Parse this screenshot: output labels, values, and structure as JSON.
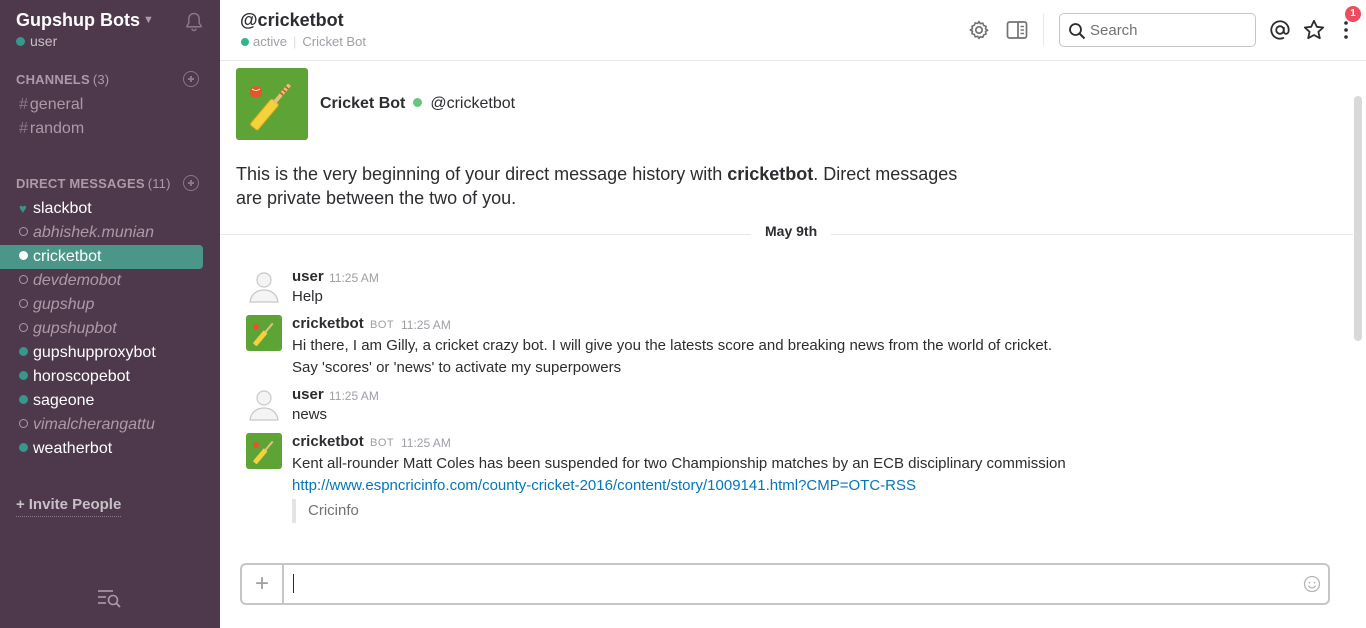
{
  "sidebar": {
    "team_name": "Gupshup Bots",
    "current_user": "user",
    "channels_header": "CHANNELS",
    "channels_count": "(3)",
    "channels": [
      {
        "label": "general"
      },
      {
        "label": "random"
      }
    ],
    "dm_header": "DIRECT MESSAGES",
    "dm_count": "(11)",
    "dms": [
      {
        "label": "slackbot",
        "status": "heart"
      },
      {
        "label": "abhishek.munian",
        "status": "away"
      },
      {
        "label": "cricketbot",
        "status": "selected"
      },
      {
        "label": "devdemobot",
        "status": "away"
      },
      {
        "label": "gupshup",
        "status": "away"
      },
      {
        "label": "gupshupbot",
        "status": "away"
      },
      {
        "label": "gupshupproxybot",
        "status": "active"
      },
      {
        "label": "horoscopebot",
        "status": "active"
      },
      {
        "label": "sageone",
        "status": "active"
      },
      {
        "label": "vimalcherangattu",
        "status": "away"
      },
      {
        "label": "weatherbot",
        "status": "active"
      }
    ],
    "invite_label": "Invite People",
    "invite_plus": "+"
  },
  "header": {
    "channel_title": "@cricketbot",
    "status": "active",
    "subtitle": "Cricket Bot",
    "search_placeholder": "Search",
    "notification_count": "1"
  },
  "intro": {
    "display_name": "Cricket Bot",
    "handle": "@cricketbot",
    "text_before": "This is the very beginning of your direct message history with ",
    "text_bold": "cricketbot",
    "text_after": ". Direct messages are private between the two of you."
  },
  "day_divider": "May 9th",
  "messages": [
    {
      "author": "user",
      "is_bot": false,
      "time": "11:25 AM",
      "lines": [
        "Help"
      ]
    },
    {
      "author": "cricketbot",
      "is_bot": true,
      "bot_label": "BOT",
      "time": "11:25 AM",
      "lines": [
        "Hi there, I am Gilly, a cricket crazy bot. I will give you the latests score and breaking news from the world of cricket.",
        "Say 'scores' or 'news' to activate my superpowers"
      ]
    },
    {
      "author": "user",
      "is_bot": false,
      "time": "11:25 AM",
      "lines": [
        "news"
      ]
    },
    {
      "author": "cricketbot",
      "is_bot": true,
      "bot_label": "BOT",
      "time": "11:25 AM",
      "lines": [
        "Kent all-rounder Matt Coles has been suspended for two Championship matches by an ECB disciplinary commission"
      ],
      "link": "http://www.espncricinfo.com/county-cricket-2016/content/story/1009141.html?CMP=OTC-RSS",
      "attachment": "Cricinfo"
    }
  ],
  "composer": {
    "plus": "+",
    "value": ""
  },
  "colors": {
    "sidebar_bg": "#4d394b",
    "selected_bg": "#4c9689",
    "presence_green": "#38978d",
    "link_blue": "#0576b9",
    "badge_red": "#eb4d5c",
    "bot_avatar_green": "#5da336"
  }
}
